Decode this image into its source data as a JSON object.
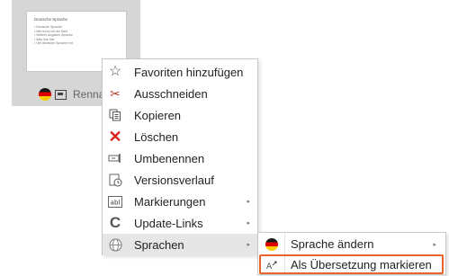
{
  "card": {
    "slide_title": "Deutsche Sprache",
    "slide_bullets": [
      "• Deutsche Sprache",
      "• Wie ist es mit der Welt",
      "• Weitere Angaben Sprache",
      "• Was ihre hier",
      "• Viel deutsche Sprache mit"
    ],
    "name": "Renna",
    "icons": [
      "german-flag-icon",
      "slide-icon"
    ]
  },
  "context_menu": {
    "items": [
      {
        "label": "Favoriten hinzufügen",
        "icon": "star-icon",
        "glyph": "☆",
        "submenu": false
      },
      {
        "label": "Ausschneiden",
        "icon": "scissors-icon",
        "glyph": "✂",
        "submenu": false
      },
      {
        "label": "Kopieren",
        "icon": "copy-icon",
        "glyph": "⎘",
        "submenu": false
      },
      {
        "label": "Löschen",
        "icon": "delete-icon",
        "glyph": "✕",
        "submenu": false
      },
      {
        "label": "Umbenennen",
        "icon": "rename-icon",
        "glyph": "▭",
        "submenu": false
      },
      {
        "label": "Versionsverlauf",
        "icon": "version-history-icon",
        "glyph": "⟲",
        "submenu": false
      },
      {
        "label": "Markierungen",
        "icon": "tags-icon",
        "glyph": "abl",
        "submenu": true
      },
      {
        "label": "Update-Links",
        "icon": "update-links-icon",
        "glyph": "C",
        "submenu": true
      },
      {
        "label": "Sprachen",
        "icon": "language-globe-icon",
        "glyph": "◍",
        "submenu": true
      }
    ],
    "active_item": "Sprachen",
    "submenu_arrow": "▸"
  },
  "language_submenu": {
    "items": [
      {
        "label": "Sprache ändern",
        "icon": "german-flag-icon",
        "submenu": true
      },
      {
        "label": "Als Übersetzung markieren",
        "icon": "mark-translation-icon",
        "glyph": "A↗",
        "submenu": false
      }
    ],
    "highlighted_item": "Als Übersetzung markieren"
  },
  "colors": {
    "highlight_border": "#e8632b",
    "delete_icon": "#d9251d",
    "scissors_icon": "#c0392b",
    "menu_hover": "#e6e6e6"
  }
}
